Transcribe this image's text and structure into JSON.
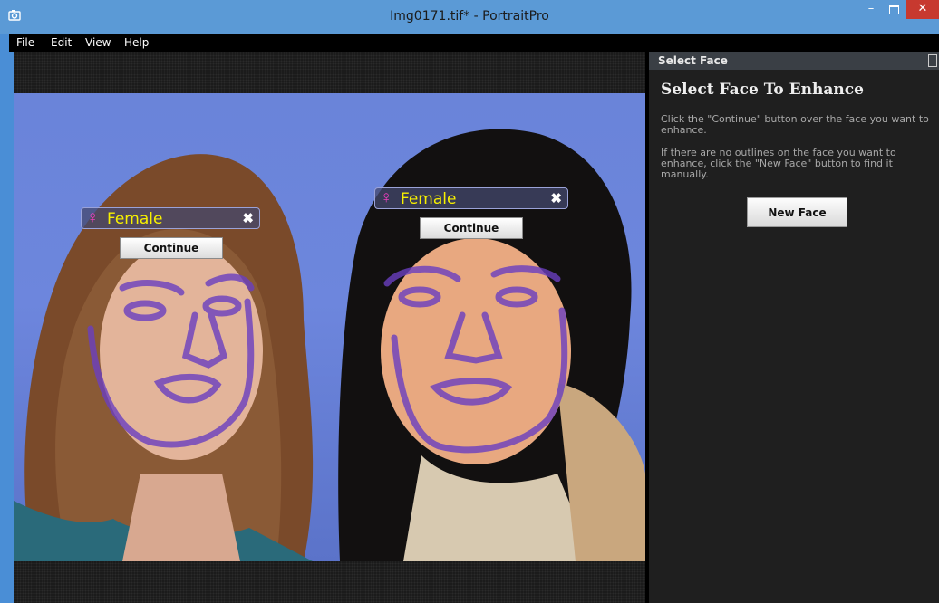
{
  "window": {
    "title": "Img0171.tif* - PortraitPro",
    "app_icon": "camera-icon",
    "controls": {
      "minimize": "–",
      "close": "✕"
    }
  },
  "menu": {
    "items": [
      "File",
      "Edit",
      "View",
      "Help"
    ]
  },
  "faces": [
    {
      "gender_icon": "♀",
      "gender": "Female",
      "close": "✖",
      "continue_label": "Continue"
    },
    {
      "gender_icon": "♀",
      "gender": "Female",
      "close": "✖",
      "continue_label": "Continue"
    }
  ],
  "panel": {
    "header": "Select Face",
    "title": "Select Face To Enhance",
    "paragraph1": "Click the \"Continue\" button over the face you want to enhance.",
    "paragraph2": "If there are no outlines on the face you want to enhance, click the \"New Face\" button to find it manually.",
    "new_face_label": "New Face"
  },
  "colors": {
    "title_bar": "#5b9ad6",
    "close_button": "#c7392f",
    "face_outline": "#6a3fc0",
    "gender_text": "#f7f000",
    "gender_icon": "#f03ec0"
  }
}
